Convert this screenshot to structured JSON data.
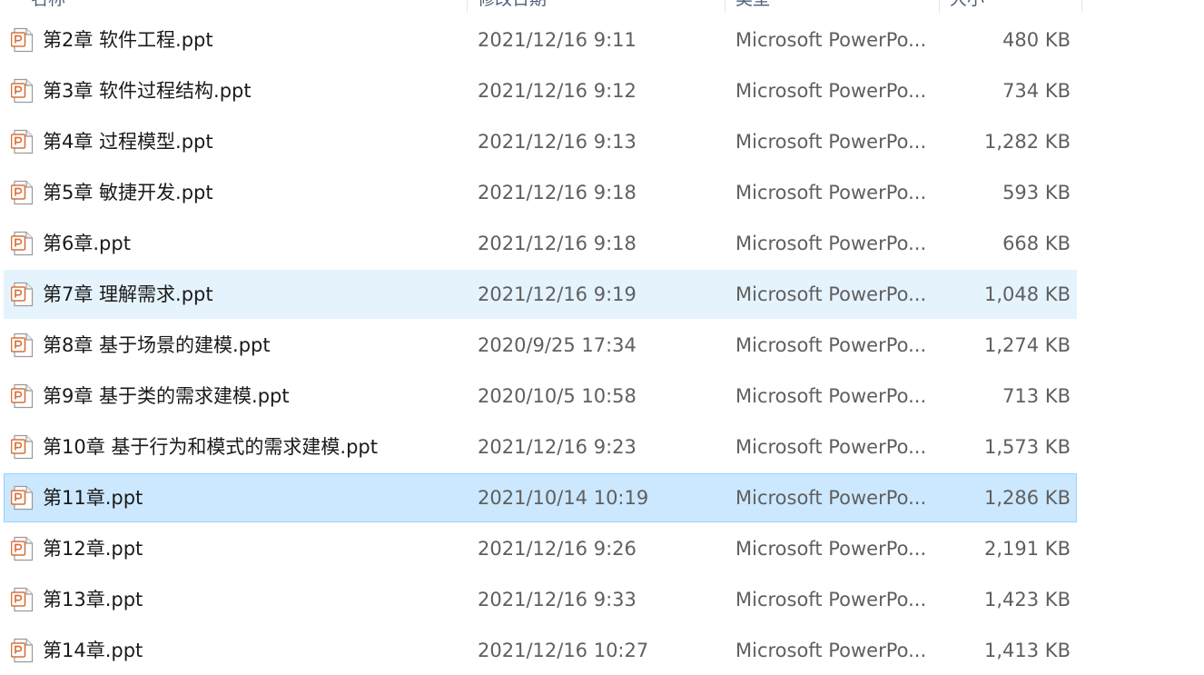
{
  "columns": {
    "name": "名称",
    "date": "修改日期",
    "type": "类型",
    "size": "大小"
  },
  "icon": "powerpoint-file-icon",
  "accent": {
    "hover": "#e5f3fd",
    "selected": "#cce8ff",
    "selected_border": "#99d1ff",
    "icon_orange": "#d9713a"
  },
  "files": [
    {
      "name": "第2章 软件工程.ppt",
      "date": "2021/12/16 9:11",
      "type": "Microsoft PowerPo...",
      "size": "480 KB",
      "state": ""
    },
    {
      "name": "第3章 软件过程结构.ppt",
      "date": "2021/12/16 9:12",
      "type": "Microsoft PowerPo...",
      "size": "734 KB",
      "state": ""
    },
    {
      "name": "第4章 过程模型.ppt",
      "date": "2021/12/16 9:13",
      "type": "Microsoft PowerPo...",
      "size": "1,282 KB",
      "state": ""
    },
    {
      "name": "第5章 敏捷开发.ppt",
      "date": "2021/12/16 9:18",
      "type": "Microsoft PowerPo...",
      "size": "593 KB",
      "state": ""
    },
    {
      "name": "第6章.ppt",
      "date": "2021/12/16 9:18",
      "type": "Microsoft PowerPo...",
      "size": "668 KB",
      "state": ""
    },
    {
      "name": "第7章 理解需求.ppt",
      "date": "2021/12/16 9:19",
      "type": "Microsoft PowerPo...",
      "size": "1,048 KB",
      "state": "hover"
    },
    {
      "name": "第8章 基于场景的建模.ppt",
      "date": "2020/9/25 17:34",
      "type": "Microsoft PowerPo...",
      "size": "1,274 KB",
      "state": ""
    },
    {
      "name": "第9章 基于类的需求建模.ppt",
      "date": "2020/10/5 10:58",
      "type": "Microsoft PowerPo...",
      "size": "713 KB",
      "state": ""
    },
    {
      "name": "第10章 基于行为和模式的需求建模.ppt",
      "date": "2021/12/16 9:23",
      "type": "Microsoft PowerPo...",
      "size": "1,573 KB",
      "state": ""
    },
    {
      "name": "第11章.ppt",
      "date": "2021/10/14 10:19",
      "type": "Microsoft PowerPo...",
      "size": "1,286 KB",
      "state": "selected"
    },
    {
      "name": "第12章.ppt",
      "date": "2021/12/16 9:26",
      "type": "Microsoft PowerPo...",
      "size": "2,191 KB",
      "state": ""
    },
    {
      "name": "第13章.ppt",
      "date": "2021/12/16 9:33",
      "type": "Microsoft PowerPo...",
      "size": "1,423 KB",
      "state": ""
    },
    {
      "name": "第14章.ppt",
      "date": "2021/12/16 10:27",
      "type": "Microsoft PowerPo...",
      "size": "1,413 KB",
      "state": ""
    }
  ]
}
